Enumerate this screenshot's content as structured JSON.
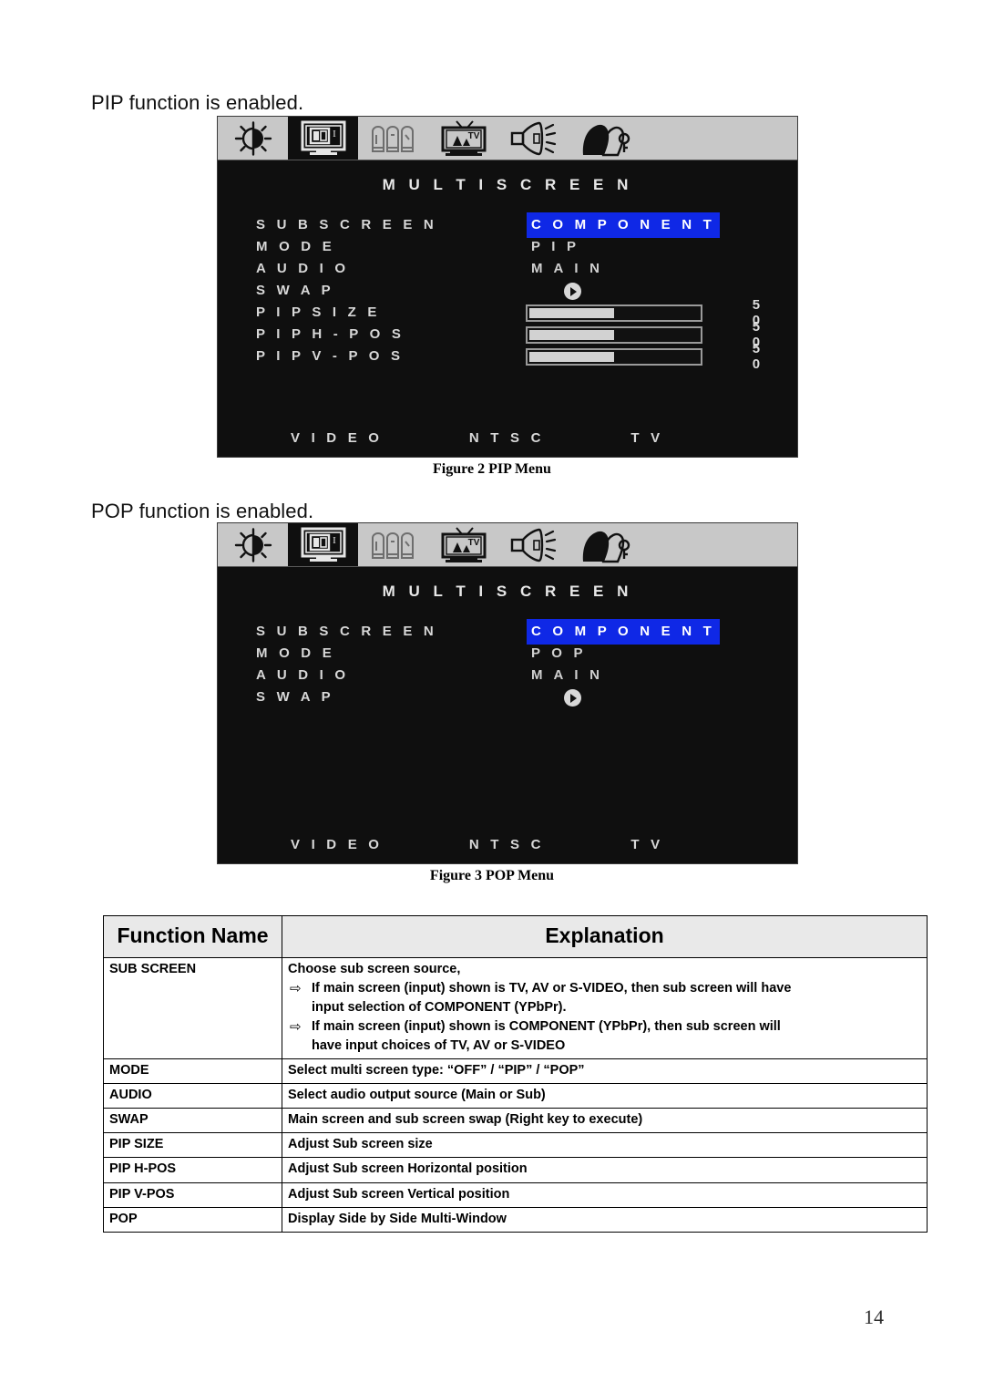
{
  "intro": {
    "pip": "PIP function is enabled.",
    "pop": "POP function is enabled."
  },
  "captions": {
    "pip": "Figure 2 PIP Menu",
    "pop": "Figure 3 POP Menu"
  },
  "osd_pip": {
    "title": "M U L T I   S C R E E N",
    "icons": [
      {
        "name": "brightness-contrast-icon",
        "selected": false
      },
      {
        "name": "multi-screen-icon",
        "selected": true
      },
      {
        "name": "osd-settings-icon",
        "selected": false
      },
      {
        "name": "tv-picture-icon",
        "selected": false
      },
      {
        "name": "audio-speaker-icon",
        "selected": false
      },
      {
        "name": "user-profile-icon",
        "selected": false
      }
    ],
    "rows": [
      {
        "label": "S U B   S C R E E N",
        "value": "C O M P O N E N T",
        "type": "highlight"
      },
      {
        "label": "M O D E",
        "value": "P I P",
        "type": "value"
      },
      {
        "label": "A U D I O",
        "value": "M A I N",
        "type": "value"
      },
      {
        "label": "S W A P",
        "value": "",
        "type": "arrow"
      },
      {
        "label": "P I P   S I Z E",
        "value": "5 0",
        "type": "slider",
        "percent": 50
      },
      {
        "label": "P I P   H - P O S",
        "value": "5 0",
        "type": "slider",
        "percent": 50
      },
      {
        "label": "P I P   V - P O S",
        "value": "5 0",
        "type": "slider",
        "percent": 50
      }
    ],
    "status": {
      "source": "V I D E O",
      "standard": "N T S C",
      "input": "T V"
    }
  },
  "osd_pop": {
    "title": "M U L T I   S C R E E N",
    "icons": [
      {
        "name": "brightness-contrast-icon",
        "selected": false
      },
      {
        "name": "multi-screen-icon",
        "selected": true
      },
      {
        "name": "osd-settings-icon",
        "selected": false
      },
      {
        "name": "tv-picture-icon",
        "selected": false
      },
      {
        "name": "audio-speaker-icon",
        "selected": false
      },
      {
        "name": "user-profile-icon",
        "selected": false
      }
    ],
    "rows": [
      {
        "label": "S U B   S C R E E N",
        "value": "C O M P O N E N T",
        "type": "highlight"
      },
      {
        "label": "M O D E",
        "value": "P O P",
        "type": "value"
      },
      {
        "label": "A U D I O",
        "value": "M A I N",
        "type": "value"
      },
      {
        "label": "S W A P",
        "value": "",
        "type": "arrow"
      }
    ],
    "status": {
      "source": "V I D E O",
      "standard": "N T S C",
      "input": "T V"
    }
  },
  "colors": {
    "highlight_blue": "#0f28e6",
    "osd_background": "#0f0f0f",
    "icon_bar_gray": "#c8c8c8"
  },
  "table": {
    "headers": {
      "name": "Function Name",
      "explanation": "Explanation"
    },
    "rows": [
      {
        "name": "SUB SCREEN",
        "lines": [
          {
            "kind": "plain",
            "text": "Choose sub screen source,"
          },
          {
            "kind": "bullet",
            "text": "If main screen (input) shown is TV, AV or S-VIDEO, then sub screen will have"
          },
          {
            "kind": "cont",
            "text": "input selection of COMPONENT (YPbPr)."
          },
          {
            "kind": "bullet",
            "text": "If main screen (input) shown is COMPONENT (YPbPr), then sub screen will"
          },
          {
            "kind": "cont",
            "text": "have input choices of TV, AV or S-VIDEO"
          }
        ]
      },
      {
        "name": "MODE",
        "lines": [
          {
            "kind": "plain",
            "text": "Select multi screen type: “OFF” / “PIP” / “POP”"
          }
        ]
      },
      {
        "name": "AUDIO",
        "lines": [
          {
            "kind": "plain",
            "text": "Select audio output source (Main or Sub)"
          }
        ]
      },
      {
        "name": "SWAP",
        "lines": [
          {
            "kind": "plain",
            "text": "Main screen and sub screen swap (Right key to execute)"
          }
        ]
      },
      {
        "name": "PIP SIZE",
        "lines": [
          {
            "kind": "plain",
            "text": "Adjust Sub screen size"
          }
        ]
      },
      {
        "name": "PIP H-POS",
        "lines": [
          {
            "kind": "plain",
            "text": "Adjust Sub screen Horizontal position"
          }
        ]
      },
      {
        "name": "PIP V-POS",
        "lines": [
          {
            "kind": "plain",
            "text": "Adjust Sub screen Vertical position"
          }
        ]
      },
      {
        "name": "POP",
        "lines": [
          {
            "kind": "plain",
            "text": "Display Side by Side Multi-Window"
          }
        ]
      }
    ],
    "bullet_glyph": "⇨"
  },
  "page_number": "14"
}
